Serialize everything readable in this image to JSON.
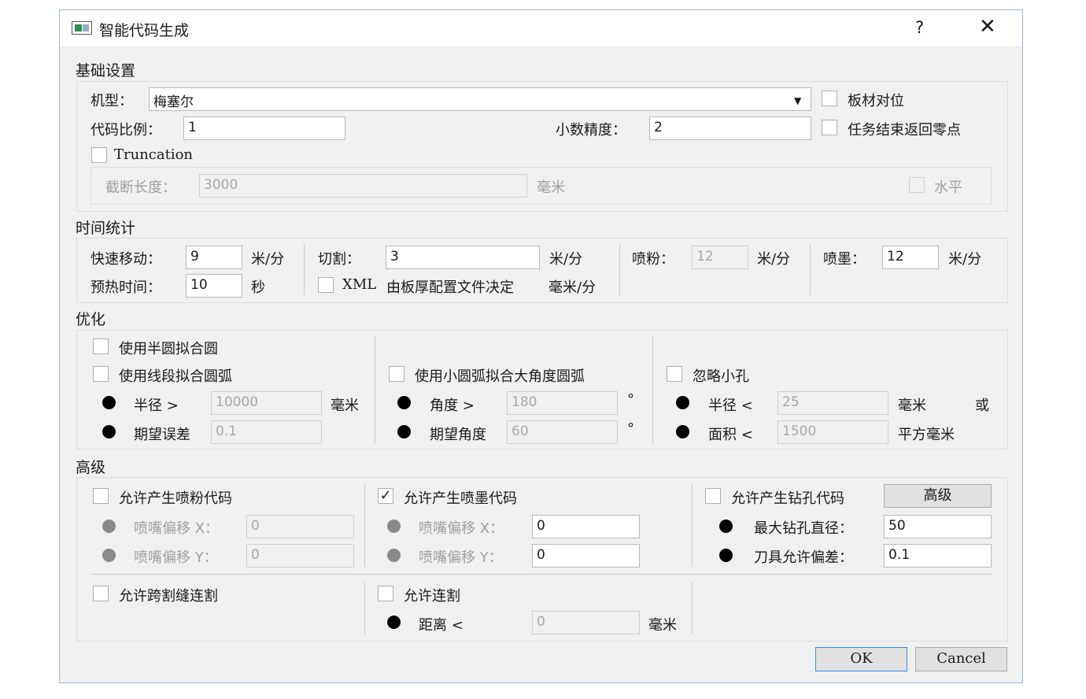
{
  "window": {
    "title": "智能代码生成",
    "help": "?",
    "close": "✕",
    "icon": "app-window-icon"
  },
  "basic": {
    "section_title": "基础设置",
    "machine_label": "机型：",
    "machine_value": "梅塞尔",
    "sheet_align_label": "板材对位",
    "scale_label": "代码比例：",
    "scale_value": "1",
    "precision_label": "小数精度：",
    "precision_value": "2",
    "return_zero_label": "任务结束返回零点",
    "truncation_label": "Truncation",
    "cut_length_label": "截断长度：",
    "cut_length_value": "3000",
    "cut_length_unit": "毫米",
    "horizontal_label": "水平"
  },
  "time": {
    "section_title": "时间统计",
    "rapid_label": "快速移动：",
    "rapid_value": "9",
    "rapid_unit": "米/分",
    "preheat_label": "预热时间：",
    "preheat_value": "10",
    "preheat_unit": "秒",
    "cut_label": "切割：",
    "cut_value": "3",
    "cut_unit": "米/分",
    "xml_label": "XML",
    "xml_text": "由板厚配置文件决定",
    "xml_unit": "毫米/分",
    "powder_label": "喷粉：",
    "powder_value": "12",
    "powder_unit": "米/分",
    "ink_label": "喷墨：",
    "ink_value": "12",
    "ink_unit": "米/分"
  },
  "optimize": {
    "section_title": "优化",
    "semicircle_label": "使用半圆拟合圆",
    "segment_label": "使用线段拟合圆弧",
    "radius_gt_label": "半径 >",
    "radius_gt_value": "10000",
    "radius_gt_unit": "毫米",
    "expected_error_label": "期望误差",
    "expected_error_value": "0.1",
    "small_arc_label": "使用小圆弧拟合大角度圆弧",
    "angle_gt_label": "角度 >",
    "angle_gt_value": "180",
    "angle_gt_unit": "°",
    "expected_angle_label": "期望角度",
    "expected_angle_value": "60",
    "expected_angle_unit": "°",
    "ignore_holes_label": "忽略小孔",
    "radius_lt_label": "半径 <",
    "radius_lt_value": "25",
    "radius_lt_unit": "毫米",
    "or_label": "或",
    "area_lt_label": "面积 <",
    "area_lt_value": "1500",
    "area_lt_unit": "平方毫米"
  },
  "advanced": {
    "section_title": "高级",
    "powder_code_label": "允许产生喷粉代码",
    "powder_offset_x_label": "喷嘴偏移 X：",
    "powder_offset_x_value": "0",
    "powder_offset_y_label": "喷嘴偏移 Y：",
    "powder_offset_y_value": "0",
    "ink_code_label": "允许产生喷墨代码",
    "ink_code_checked": true,
    "ink_check_mark": "✓",
    "ink_offset_x_label": "喷嘴偏移 X：",
    "ink_offset_x_value": "0",
    "ink_offset_y_label": "喷嘴偏移 Y：",
    "ink_offset_y_value": "0",
    "drill_code_label": "允许产生钻孔代码",
    "advanced_button": "高级",
    "max_drill_label": "最大钻孔直径：",
    "max_drill_value": "50",
    "tool_tolerance_label": "刀具允许偏差：",
    "tool_tolerance_value": "0.1",
    "cross_seam_label": "允许跨割缝连割",
    "chain_cut_label": "允许连割",
    "distance_label": "距离 <",
    "distance_value": "0",
    "distance_unit": "毫米"
  },
  "footer": {
    "ok": "OK",
    "cancel": "Cancel"
  }
}
